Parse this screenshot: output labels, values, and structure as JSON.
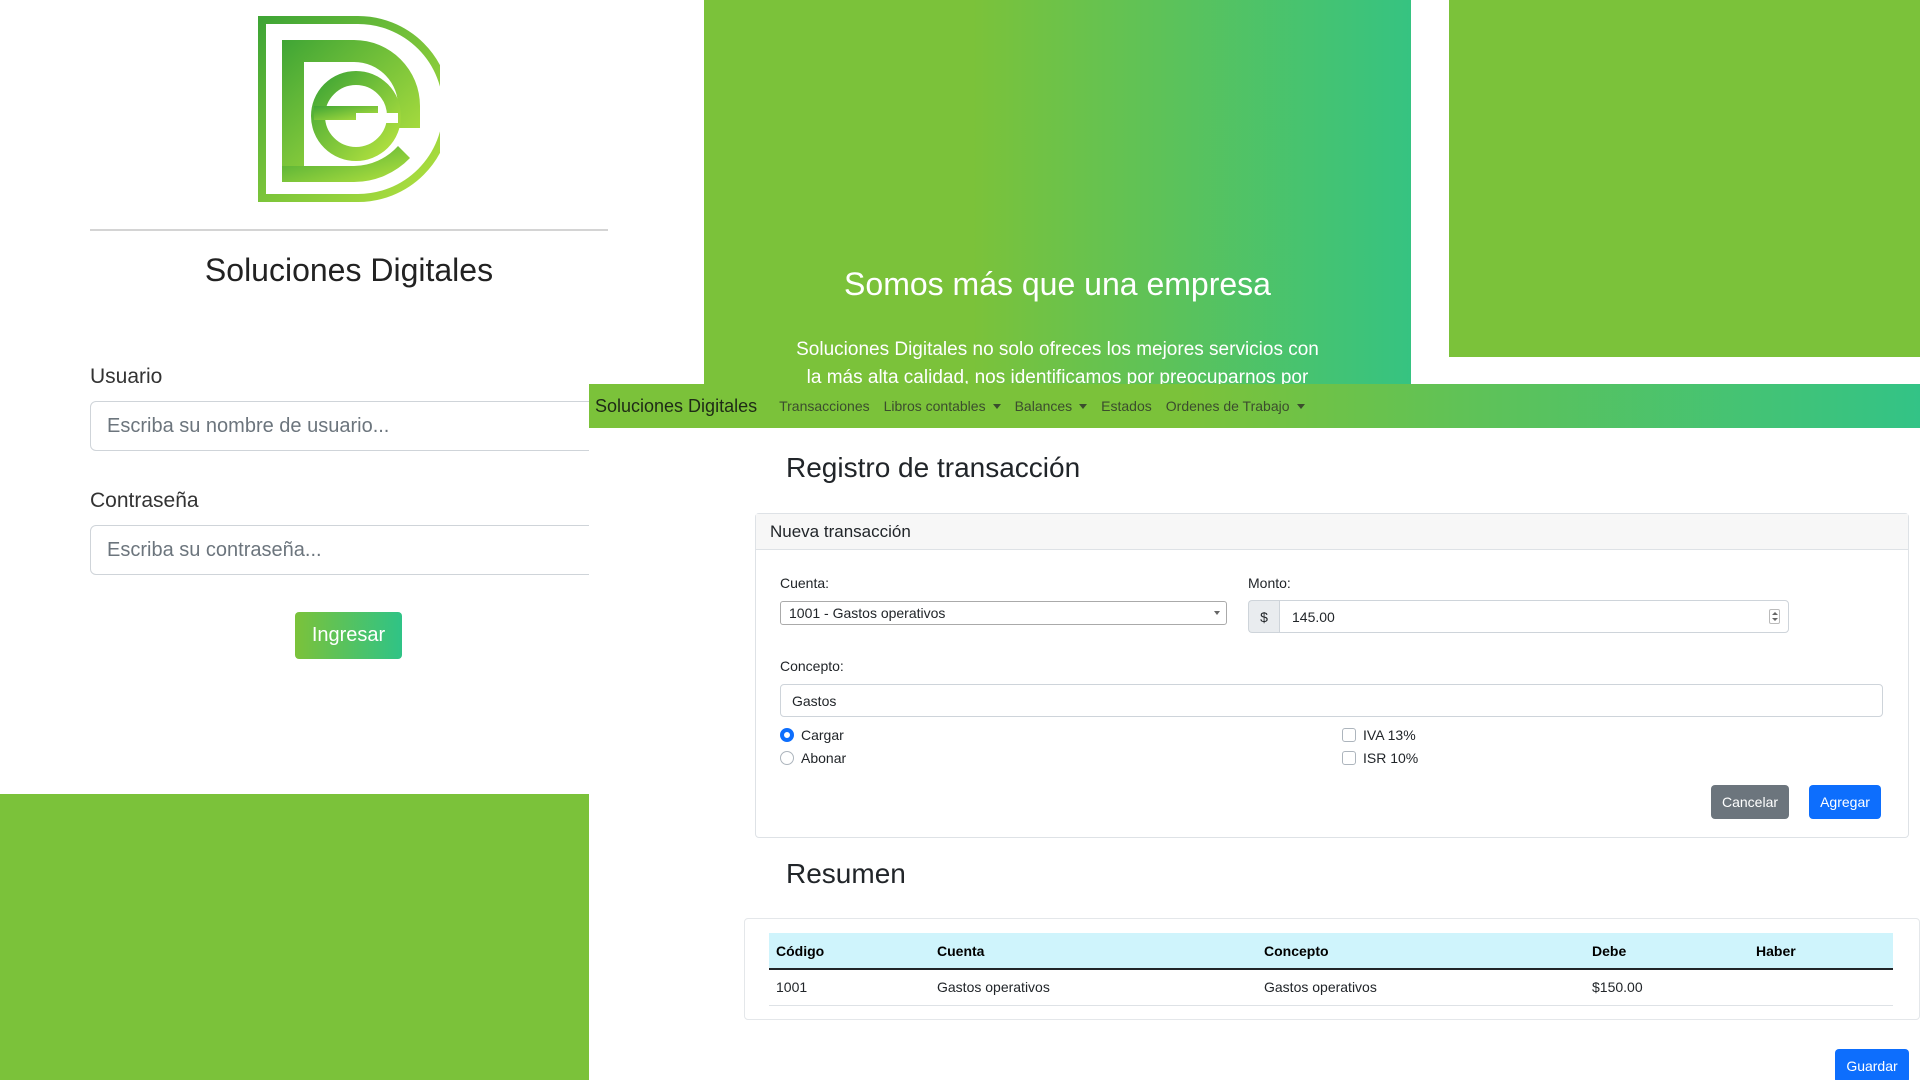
{
  "colors": {
    "green": "#7bc23a",
    "teal": "#2fc386",
    "primary": "#0d6efd",
    "secondary": "#6c757d",
    "table_head": "#cff4fc"
  },
  "login": {
    "logo_icon": "sd-logo-icon",
    "title": "Soluciones Digitales",
    "user_label": "Usuario",
    "user_placeholder": "Escriba su nombre de usuario...",
    "password_label": "Contraseña",
    "password_placeholder": "Escriba su contraseña...",
    "submit_label": "Ingresar"
  },
  "hero": {
    "title": "Somos más que una empresa",
    "text": "Soluciones Digitales no solo ofreces los mejores servicios con la más alta calidad, nos identificamos por preocuparnos por"
  },
  "app": {
    "brand": "Soluciones Digitales",
    "nav": [
      {
        "label": "Transacciones",
        "dropdown": false
      },
      {
        "label": "Libros contables",
        "dropdown": true
      },
      {
        "label": "Balances",
        "dropdown": true
      },
      {
        "label": "Estados",
        "dropdown": false
      },
      {
        "label": "Ordenes de Trabajo",
        "dropdown": true
      }
    ],
    "page_title": "Registro de transacción",
    "card_header": "Nueva transacción",
    "form": {
      "cuenta_label": "Cuenta:",
      "cuenta_value": "1001 - Gastos operativos",
      "monto_label": "Monto:",
      "monto_prefix": "$",
      "monto_value": "145.00",
      "concepto_label": "Concepto:",
      "concepto_value": "Gastos",
      "radio_cargar": "Cargar",
      "radio_abonar": "Abonar",
      "selected_radio": "Cargar",
      "check_iva": "IVA 13%",
      "check_isr": "ISR 10%",
      "cancel_label": "Cancelar",
      "add_label": "Agregar"
    },
    "summary_title": "Resumen",
    "table": {
      "headers": [
        "Código",
        "Cuenta",
        "Concepto",
        "Debe",
        "Haber"
      ],
      "rows": [
        [
          "1001",
          "Gastos operativos",
          "Gastos operativos",
          "$150.00",
          ""
        ]
      ]
    },
    "save_label": "Guardar"
  }
}
